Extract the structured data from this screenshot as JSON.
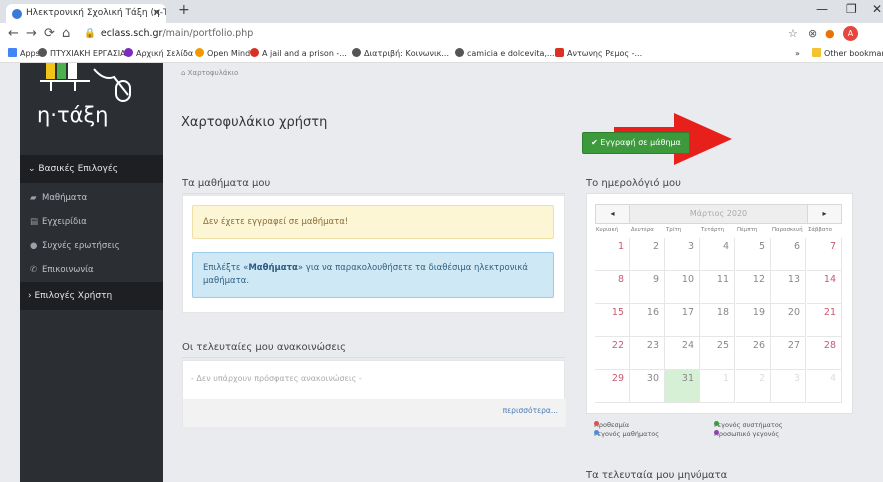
{
  "browser": {
    "tab_title": "Ηλεκτρονική Σχολική Τάξη (η-Τάξη)",
    "tab_close": "✕",
    "new_tab": "+",
    "win_min": "—",
    "win_max": "❐",
    "win_close": "✕",
    "url_host": "eclass.sch.gr",
    "url_path": "/main/portfolio.php",
    "profile_letter": "A",
    "bookmarks": [
      {
        "label": "Apps",
        "color": "#4285f4"
      },
      {
        "label": "ΠΤΥΧΙΑΚΗ ΕΡΓΑΣΙΑ",
        "color": "#555555"
      },
      {
        "label": "Αρχική Σελίδα",
        "color": "#7b2cbf"
      },
      {
        "label": "Open Mind",
        "color": "#f29900"
      },
      {
        "label": "A jail and a prison -...",
        "color": "#d93025"
      },
      {
        "label": "Διατριβή: Κοινωνικ...",
        "color": "#555555"
      },
      {
        "label": "camicia e dolcevita,...",
        "color": "#555555"
      },
      {
        "label": "Αντωνης Ρεμος -...",
        "color": "#d93025"
      }
    ],
    "more_bookmarks": "»",
    "other_bookmarks": "Other bookmarks"
  },
  "sidebar": {
    "logo_text": "η·τάξη",
    "section_basic": "Βασικές Επιλογές",
    "items": [
      {
        "label": "Μαθήματα",
        "icon": "graduation-cap-icon",
        "glyph": "🎓"
      },
      {
        "label": "Εγχειρίδια",
        "icon": "document-icon",
        "glyph": "▤"
      },
      {
        "label": "Συχνές ερωτήσεις",
        "icon": "question-icon",
        "glyph": "❓"
      },
      {
        "label": "Επικοινωνία",
        "icon": "phone-icon",
        "glyph": "✆"
      }
    ],
    "section_user": "Επιλογές Χρήστη"
  },
  "main": {
    "breadcrumb": "Χαρτοφυλάκιο",
    "page_title": "Χαρτοφυλάκιο χρήστη",
    "enroll_button": "Εγγραφή σε μάθημα",
    "my_courses_title": "Τα μαθήματα μου",
    "alert_warning": "Δεν έχετε εγγραφεί σε μαθήματα!",
    "alert_info_prefix": "Επιλέξτε «",
    "alert_info_bold": "Μαθήματα",
    "alert_info_suffix": "» για να παρακολουθήσετε τα διαθέσιμα ηλεκτρονικά μαθήματα.",
    "announcements_title": "Οι τελευταίες μου ανακοινώσεις",
    "announcements_empty": "- Δεν υπάρχουν πρόσφατες ανακοινώσεις -",
    "more_link": "περισσότερα...",
    "calendar_title": "Το ημερολόγιό μου",
    "messages_title": "Τα τελευταία μου μηνύματα"
  },
  "calendar": {
    "month_label": "Μάρτιος 2020",
    "prev": "◂",
    "next": "▸",
    "weekdays": [
      "Κυριακή",
      "Δευτέρα",
      "Τρίτη",
      "Τετάρτη",
      "Πέμπτη",
      "Παρασκευή",
      "Σάββατο"
    ],
    "weeks": [
      [
        "1",
        "2",
        "3",
        "4",
        "5",
        "6",
        "7"
      ],
      [
        "8",
        "9",
        "10",
        "11",
        "12",
        "13",
        "14"
      ],
      [
        "15",
        "16",
        "17",
        "18",
        "19",
        "20",
        "21"
      ],
      [
        "22",
        "23",
        "24",
        "25",
        "26",
        "27",
        "28"
      ],
      [
        "29",
        "30",
        "31",
        "1",
        "2",
        "3",
        "4"
      ]
    ],
    "today": "31",
    "legend": [
      {
        "label": "Προθεσμία",
        "color": "#d9534f"
      },
      {
        "label": "Γεγονός συστήματος",
        "color": "#3c9a3c"
      },
      {
        "label": "Γεγονός μαθήματος",
        "color": "#4a90d9"
      },
      {
        "label": "Προσωπικό γεγονός",
        "color": "#8e44ad"
      }
    ]
  },
  "colors": {
    "sidebar_bg": "#2b2e33",
    "accent_green": "#3c9a3c",
    "annotation_arrow": "#e8201c"
  }
}
